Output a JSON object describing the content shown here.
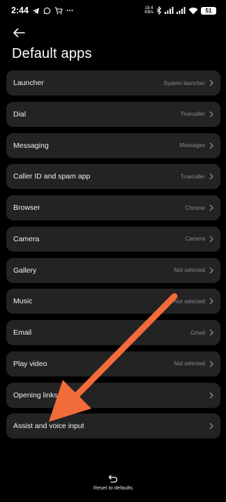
{
  "status_bar": {
    "time": "2:44",
    "net_speed_value": "18.4",
    "net_speed_unit": "KB/s",
    "battery": "51"
  },
  "header": {
    "back_icon": "back-arrow-icon",
    "title": "Default apps"
  },
  "items": [
    {
      "label": "Launcher",
      "value": "System launcher"
    },
    {
      "label": "Dial",
      "value": "Truecaller"
    },
    {
      "label": "Messaging",
      "value": "Messages"
    },
    {
      "label": "Caller ID and spam app",
      "value": "Truecaller"
    },
    {
      "label": "Browser",
      "value": "Chrome"
    },
    {
      "label": "Camera",
      "value": "Camera"
    },
    {
      "label": "Gallery",
      "value": "Not selected"
    },
    {
      "label": "Music",
      "value": "Not selected"
    },
    {
      "label": "Email",
      "value": "Gmail"
    },
    {
      "label": "Play video",
      "value": "Not selected"
    },
    {
      "label": "Opening links",
      "value": ""
    },
    {
      "label": "Assist and voice input",
      "value": ""
    }
  ],
  "footer": {
    "reset_label": "Reset to defaults",
    "reset_icon": "undo-icon"
  },
  "colors": {
    "background": "#000000",
    "card": "#232323",
    "annotation_arrow": "#F26B3A"
  }
}
